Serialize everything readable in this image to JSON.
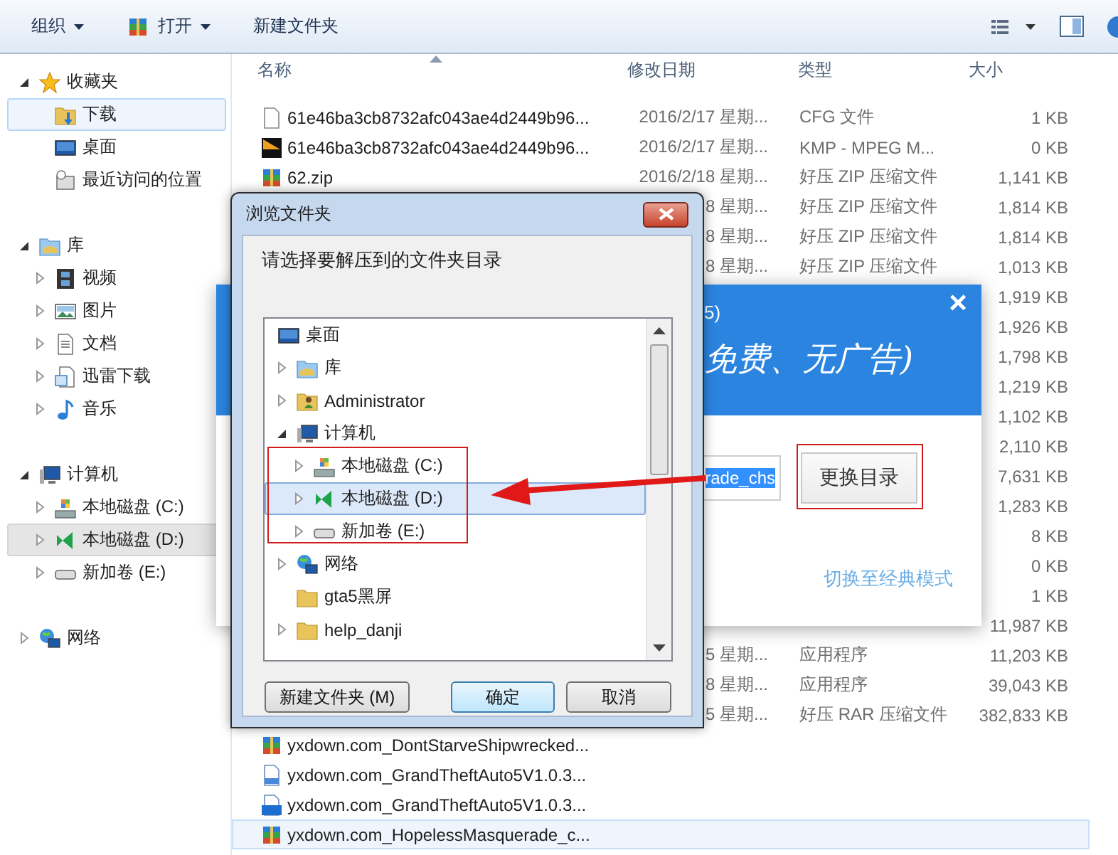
{
  "toolbar": {
    "buttons": [
      {
        "label": "组织",
        "menu": true
      },
      {
        "label": "打开",
        "kind": "zip",
        "menu": true
      },
      {
        "label": "新建文件夹",
        "menu": false
      }
    ]
  },
  "nav": [
    {
      "label": "收藏夹",
      "kind": "star",
      "expanded": true,
      "selected": false,
      "hovered": false,
      "children": [
        {
          "label": "下载",
          "kind": "download",
          "selected": false,
          "hovered": true
        },
        {
          "label": "桌面",
          "kind": "desktop",
          "selected": false,
          "hovered": false
        },
        {
          "label": "最近访问的位置",
          "kind": "recent",
          "selected": false,
          "hovered": false
        }
      ]
    },
    {
      "label": "库",
      "kind": "library",
      "expanded": true,
      "selected": false,
      "hovered": false,
      "children": [
        {
          "label": "视频",
          "kind": "video",
          "expanded": false,
          "selected": false,
          "hovered": false
        },
        {
          "label": "图片",
          "kind": "picture",
          "expanded": false,
          "selected": false,
          "hovered": false
        },
        {
          "label": "文档",
          "kind": "document",
          "expanded": false,
          "selected": false,
          "hovered": false
        },
        {
          "label": "迅雷下载",
          "kind": "thunder",
          "expanded": false,
          "selected": false,
          "hovered": false
        },
        {
          "label": "音乐",
          "kind": "music",
          "expanded": false,
          "selected": false,
          "hovered": false
        }
      ]
    },
    {
      "label": "计算机",
      "kind": "computer",
      "expanded": true,
      "selected": false,
      "hovered": false,
      "children": [
        {
          "label": "本地磁盘 (C:)",
          "kind": "drive_c",
          "expanded": false,
          "selected": false,
          "hovered": false
        },
        {
          "label": "本地磁盘 (D:)",
          "kind": "drive_d",
          "expanded": false,
          "selected": true,
          "hovered": false
        },
        {
          "label": "新加卷 (E:)",
          "kind": "drive_e",
          "expanded": false,
          "selected": false,
          "hovered": false
        }
      ]
    },
    {
      "label": "网络",
      "kind": "network",
      "expanded": false,
      "selected": false,
      "hovered": false
    }
  ],
  "columns": [
    "名称",
    "修改日期",
    "类型",
    "大小"
  ],
  "files": [
    {
      "name": "61e46ba3cb8732afc043ae4d2449b96...",
      "kind": "file",
      "date": "2016/2/17 星期...",
      "type": "CFG 文件",
      "size": "1 KB",
      "hovered": false
    },
    {
      "name": "61e46ba3cb8732afc043ae4d2449b96...",
      "kind": "dat",
      "date": "2016/2/17 星期...",
      "type": "KMP - MPEG M...",
      "size": "0 KB",
      "hovered": false
    },
    {
      "name": "62.zip",
      "kind": "zip",
      "date": "2016/2/18 星期...",
      "type": "好压 ZIP 压缩文件",
      "size": "1,141 KB",
      "hovered": false
    },
    {
      "date": "8 星期...",
      "type": "好压 ZIP 压缩文件",
      "size": "1,814 KB",
      "hovered": false
    },
    {
      "date": "8 星期...",
      "type": "好压 ZIP 压缩文件",
      "size": "1,814 KB",
      "hovered": false
    },
    {
      "date": "8 星期...",
      "type": "好压 ZIP 压缩文件",
      "size": "1,013 KB",
      "hovered": false
    },
    {
      "size": "1,919 KB",
      "hovered": false
    },
    {
      "size": "1,926 KB",
      "hovered": false
    },
    {
      "size": "1,798 KB",
      "hovered": false
    },
    {
      "size": "1,219 KB",
      "hovered": false
    },
    {
      "size": "1,102 KB",
      "hovered": false
    },
    {
      "size": "2,110 KB",
      "hovered": false
    },
    {
      "size": "7,631 KB",
      "hovered": false
    },
    {
      "size": "1,283 KB",
      "hovered": false
    },
    {
      "size": "8 KB",
      "hovered": false
    },
    {
      "size": "0 KB",
      "hovered": false
    },
    {
      "size": "1 KB",
      "hovered": false
    },
    {
      "size": "11,987 KB",
      "hovered": false
    },
    {
      "date": "5 星期...",
      "type": "应用程序",
      "size": "11,203 KB",
      "hovered": false
    },
    {
      "date": "8 星期...",
      "type": "应用程序",
      "size": "39,043 KB",
      "hovered": false
    },
    {
      "date": "5 星期...",
      "type": "好压 RAR 压缩文件",
      "size": "382,833 KB",
      "hovered": false
    },
    {
      "name": "yxdown.com_DontStarveShipwrecked...",
      "kind": "zip",
      "hovered": false
    },
    {
      "name": "yxdown.com_GrandTheftAuto5V1.0.3...",
      "kind": "txt",
      "hovered": false
    },
    {
      "name": "yxdown.com_GrandTheftAuto5V1.0.3...",
      "kind": "bt",
      "hovered": false
    },
    {
      "name": "yxdown.com_HopelessMasquerade_c...",
      "kind": "zip",
      "hovered": true
    }
  ],
  "installer": {
    "close": "×",
    "subtitle": "5)",
    "slogan": "免费、无广告)",
    "path": "rade_chs",
    "change_button": "更换目录",
    "classic_link": "切换至经典模式"
  },
  "browse_dialog": {
    "title": "浏览文件夹",
    "prompt": "请选择要解压到的文件夹目录",
    "tree": [
      {
        "label": "桌面",
        "kind": "desktop",
        "selected": false,
        "children": [
          {
            "label": "库",
            "kind": "library",
            "expanded": false,
            "selected": false
          },
          {
            "label": "Administrator",
            "kind": "user",
            "expanded": false,
            "selected": false
          },
          {
            "label": "计算机",
            "kind": "computer",
            "expanded": true,
            "selected": false,
            "children": [
              {
                "label": "本地磁盘 (C:)",
                "kind": "drive_c",
                "expanded": false,
                "selected": false
              },
              {
                "label": "本地磁盘 (D:)",
                "kind": "drive_d",
                "expanded": false,
                "selected": true
              },
              {
                "label": "新加卷 (E:)",
                "kind": "drive_e",
                "expanded": false,
                "selected": false
              }
            ]
          },
          {
            "label": "网络",
            "kind": "network",
            "expanded": false,
            "selected": false
          },
          {
            "label": "gta5黑屏",
            "kind": "folder",
            "selected": false
          },
          {
            "label": "help_danji",
            "kind": "folder",
            "expanded": false,
            "selected": false
          }
        ]
      }
    ],
    "buttons": [
      {
        "label": "新建文件夹 (M)",
        "default": false
      },
      {
        "label": "确定",
        "default": true
      },
      {
        "label": "取消",
        "default": false
      }
    ]
  }
}
